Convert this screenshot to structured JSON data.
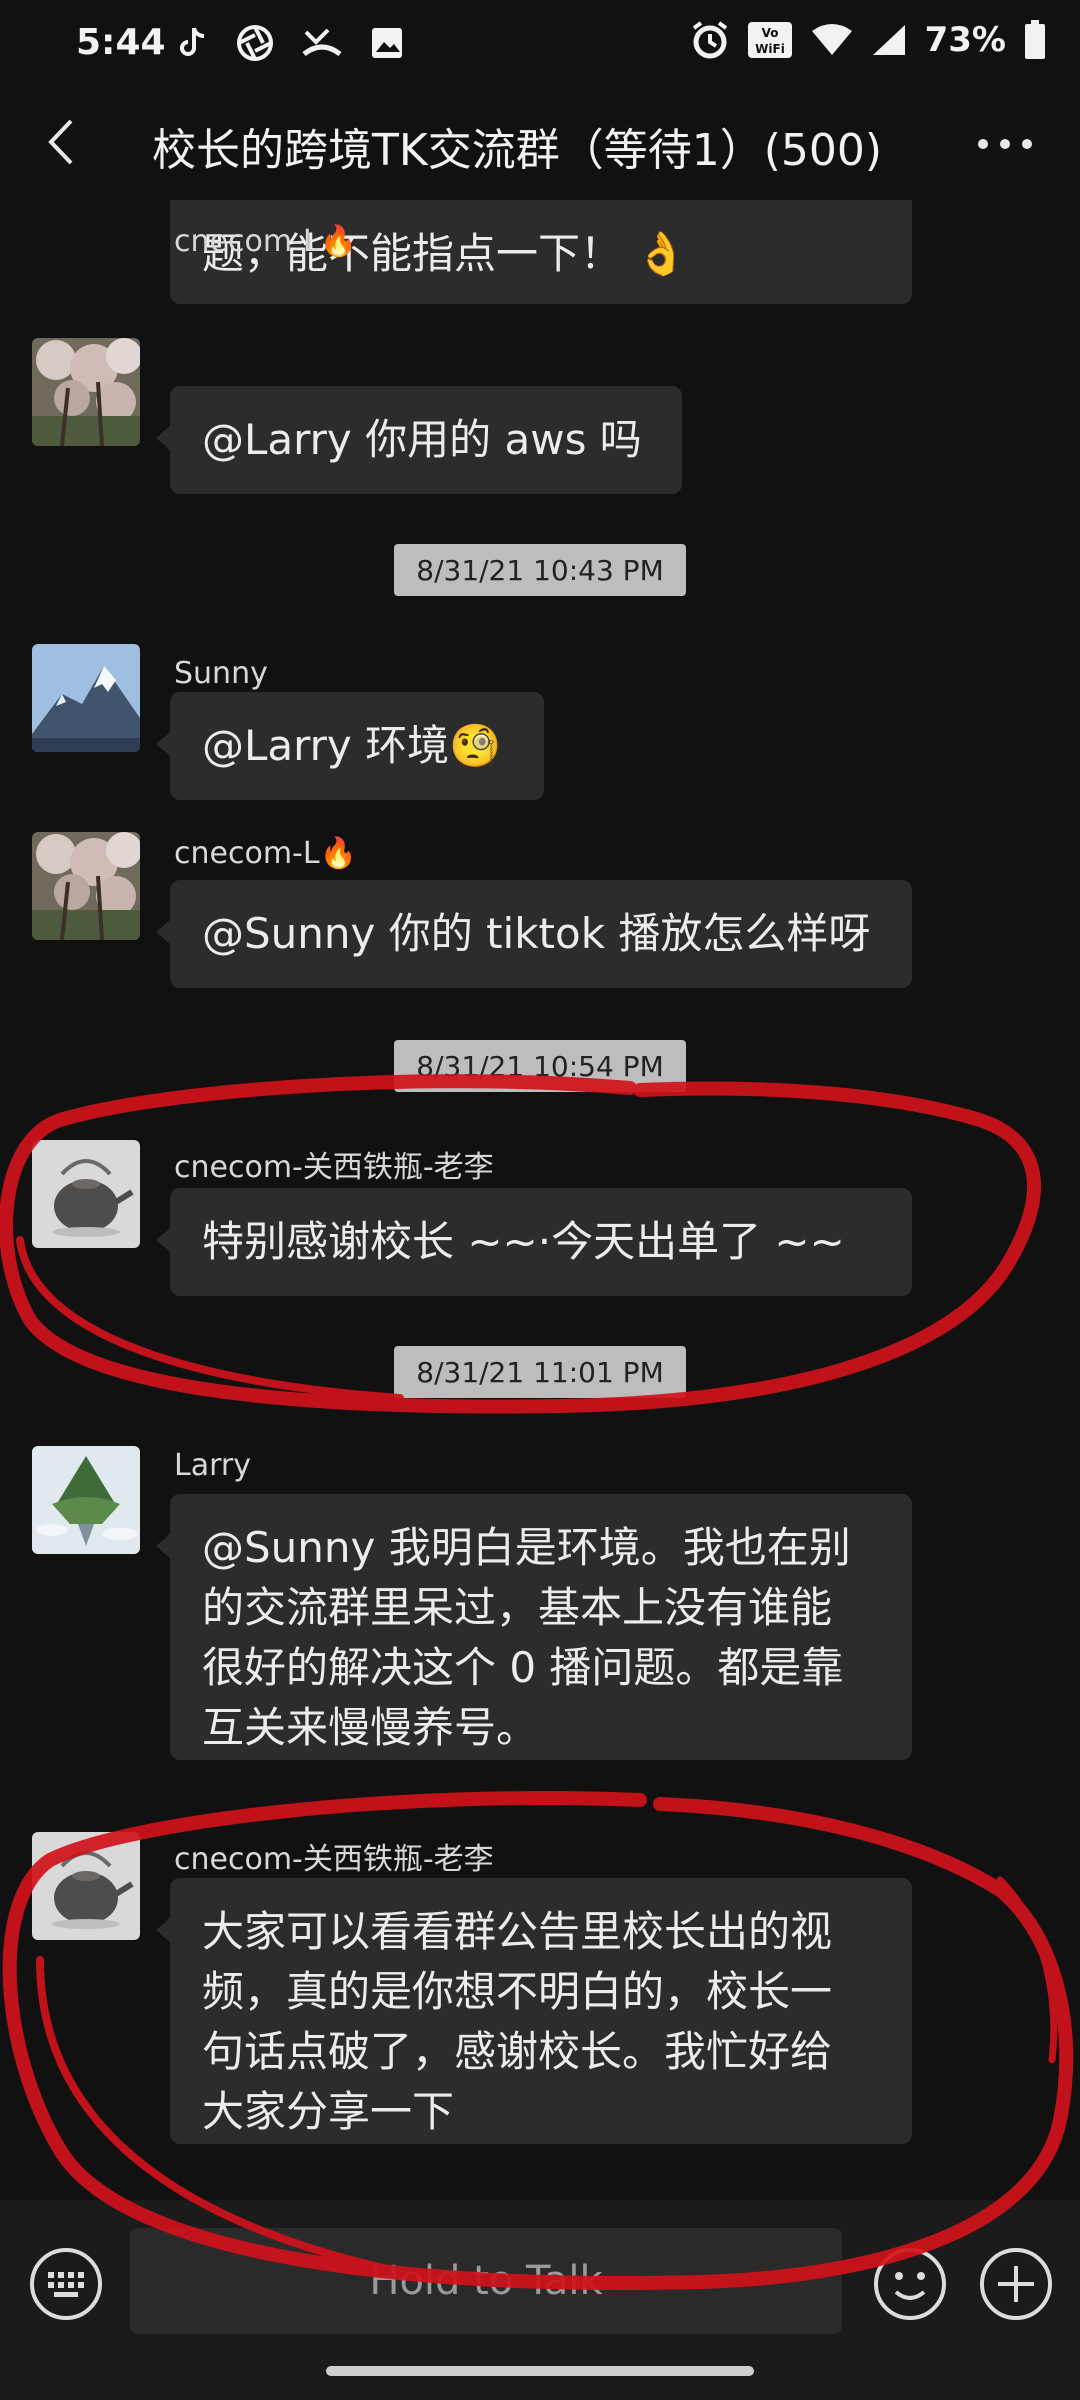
{
  "status_bar": {
    "time": "5:44",
    "battery": "73%",
    "icons_left": [
      "tiktok-icon",
      "aperture-icon",
      "missed-call-icon",
      "image-icon"
    ],
    "icons_right": [
      "alarm-icon",
      "vowifi-icon",
      "wifi-icon",
      "signal-icon",
      "battery-icon"
    ]
  },
  "header": {
    "title": "校长的跨境TK交流群（等待1）(500)"
  },
  "messages": [
    {
      "type": "partial",
      "text": "题，能不能指点一下！ 👌"
    },
    {
      "type": "msg",
      "sender": "cnecom-L🔥",
      "avatar": "blossom-avatar",
      "text": "@Larry  你用的 aws 吗"
    },
    {
      "type": "time",
      "text": "8/31/21 10:43 PM"
    },
    {
      "type": "msg",
      "sender": "Sunny",
      "avatar": "mountain-avatar",
      "text": "@Larry  环境🧐"
    },
    {
      "type": "msg",
      "sender": "cnecom-L🔥",
      "avatar": "blossom-avatar",
      "text": "@Sunny  你的 tiktok 播放怎么样呀"
    },
    {
      "type": "time",
      "text": "8/31/21 10:54 PM"
    },
    {
      "type": "msg",
      "sender": "cnecom-关西铁瓶-老李",
      "avatar": "teapot-avatar",
      "text": "特别感谢校长 ~~·今天出单了 ~~"
    },
    {
      "type": "time",
      "text": "8/31/21 11:01 PM"
    },
    {
      "type": "msg",
      "sender": "Larry",
      "avatar": "floating-island-avatar",
      "lines": [
        "@Sunny  我明白是环境。我也在别",
        "的交流群里呆过，基本上没有谁能",
        "很好的解决这个 0 播问题。都是靠",
        "互关来慢慢养号。"
      ]
    },
    {
      "type": "msg",
      "sender": "cnecom-关西铁瓶-老李",
      "avatar": "teapot-avatar",
      "lines": [
        "大家可以看看群公告里校长出的视",
        "频，真的是你想不明白的，校长一",
        "句话点破了，感谢校长。我忙好给",
        "大家分享一下"
      ]
    }
  ],
  "input_bar": {
    "hold_to_talk": "Hold to Talk"
  },
  "colors": {
    "background": "#111111",
    "bubble": "#2c2c2c",
    "timestamp_bg": "#bdbdbd",
    "annotation": "#d0121b"
  }
}
